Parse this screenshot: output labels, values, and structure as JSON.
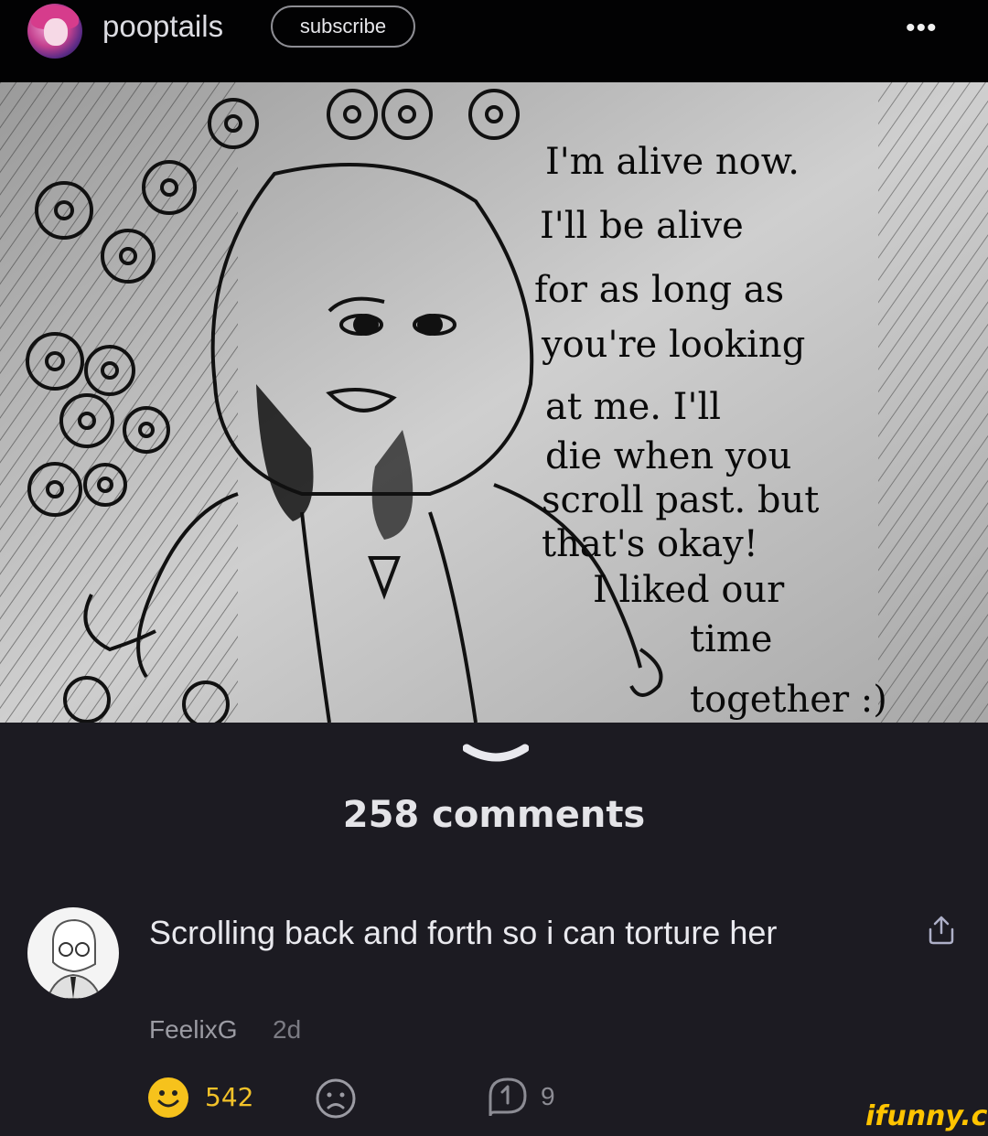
{
  "header": {
    "username": "pooptails",
    "subscribe_label": "subscribe",
    "more_icon": "•••"
  },
  "post": {
    "image_text": [
      "I'm alive now.",
      "I'll be alive",
      "for as long as",
      "you're looking",
      "at me. I'll",
      "die when you",
      "scroll past. but",
      "that's okay!",
      "I liked our",
      "time",
      "together :)"
    ]
  },
  "comments": {
    "count_label": "258 comments",
    "items": [
      {
        "text": "Scrolling back and forth so i can torture her",
        "author": "FeelixG",
        "time": "2d",
        "likes": "542",
        "replies": "9"
      }
    ]
  },
  "watermark": "ifunny.co",
  "colors": {
    "background": "#1c1b22",
    "topbar": "#020203",
    "like_yellow": "#f6c21c",
    "watermark": "#ffc400"
  }
}
